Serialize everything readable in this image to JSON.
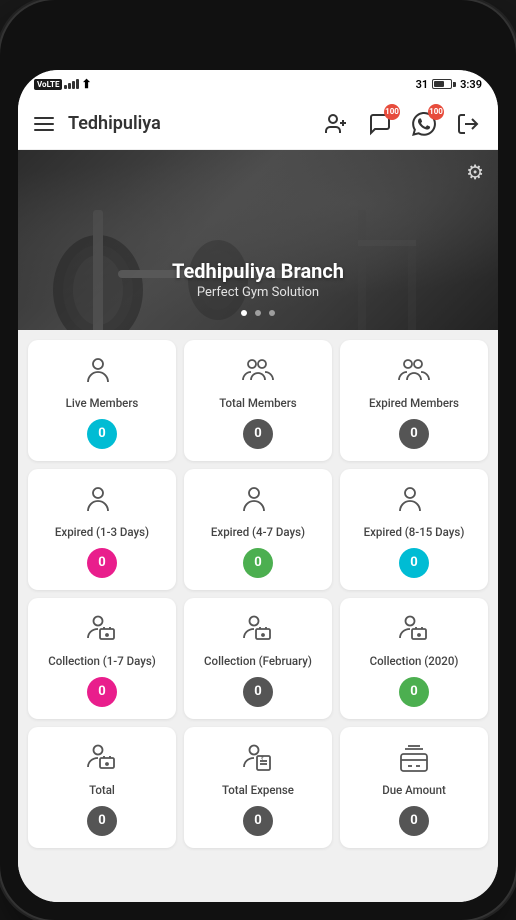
{
  "status_bar": {
    "carrier": "VoLTE",
    "signal": "4 bars",
    "battery_level": "31",
    "time": "3:39"
  },
  "header": {
    "menu_label": "Menu",
    "title": "Tedhipuliya",
    "add_member_label": "Add Member",
    "messages_label": "Messages",
    "whatsapp_label": "WhatsApp",
    "logout_label": "Logout",
    "messages_badge": "100",
    "whatsapp_badge": "100"
  },
  "hero": {
    "title": "Tedhipuliya Branch",
    "subtitle": "Perfect Gym Solution",
    "settings_label": "Settings"
  },
  "cards": [
    {
      "id": "live-members",
      "label": "Live Members",
      "count": "0",
      "badge_color": "badge-teal",
      "icon_type": "single-person"
    },
    {
      "id": "total-members",
      "label": "Total Members",
      "count": "0",
      "badge_color": "badge-dark",
      "icon_type": "group-person"
    },
    {
      "id": "expired-members",
      "label": "Expired Members",
      "count": "0",
      "badge_color": "badge-dark",
      "icon_type": "group-person"
    },
    {
      "id": "expired-1-3",
      "label": "Expired (1-3 Days)",
      "count": "0",
      "badge_color": "badge-pink",
      "icon_type": "single-person"
    },
    {
      "id": "expired-4-7",
      "label": "Expired (4-7 Days)",
      "count": "0",
      "badge_color": "badge-green",
      "icon_type": "single-person"
    },
    {
      "id": "expired-8-15",
      "label": "Expired (8-15 Days)",
      "count": "0",
      "badge_color": "badge-teal",
      "icon_type": "single-person"
    },
    {
      "id": "collection-1-7",
      "label": "Collection (1-7 Days)",
      "count": "0",
      "badge_color": "badge-pink",
      "icon_type": "money-person"
    },
    {
      "id": "collection-feb",
      "label": "Collection (February)",
      "count": "0",
      "badge_color": "badge-dark",
      "icon_type": "money-person"
    },
    {
      "id": "collection-2020",
      "label": "Collection (2020)",
      "count": "0",
      "badge_color": "badge-green",
      "icon_type": "money-person"
    },
    {
      "id": "total",
      "label": "Total",
      "count": "0",
      "badge_color": "badge-dark",
      "icon_type": "money-person"
    },
    {
      "id": "total-expense",
      "label": "Total Expense",
      "count": "0",
      "badge_color": "badge-dark",
      "icon_type": "bill-person"
    },
    {
      "id": "due-amount",
      "label": "Due Amount",
      "count": "0",
      "badge_color": "badge-dark",
      "icon_type": "wallet"
    }
  ]
}
